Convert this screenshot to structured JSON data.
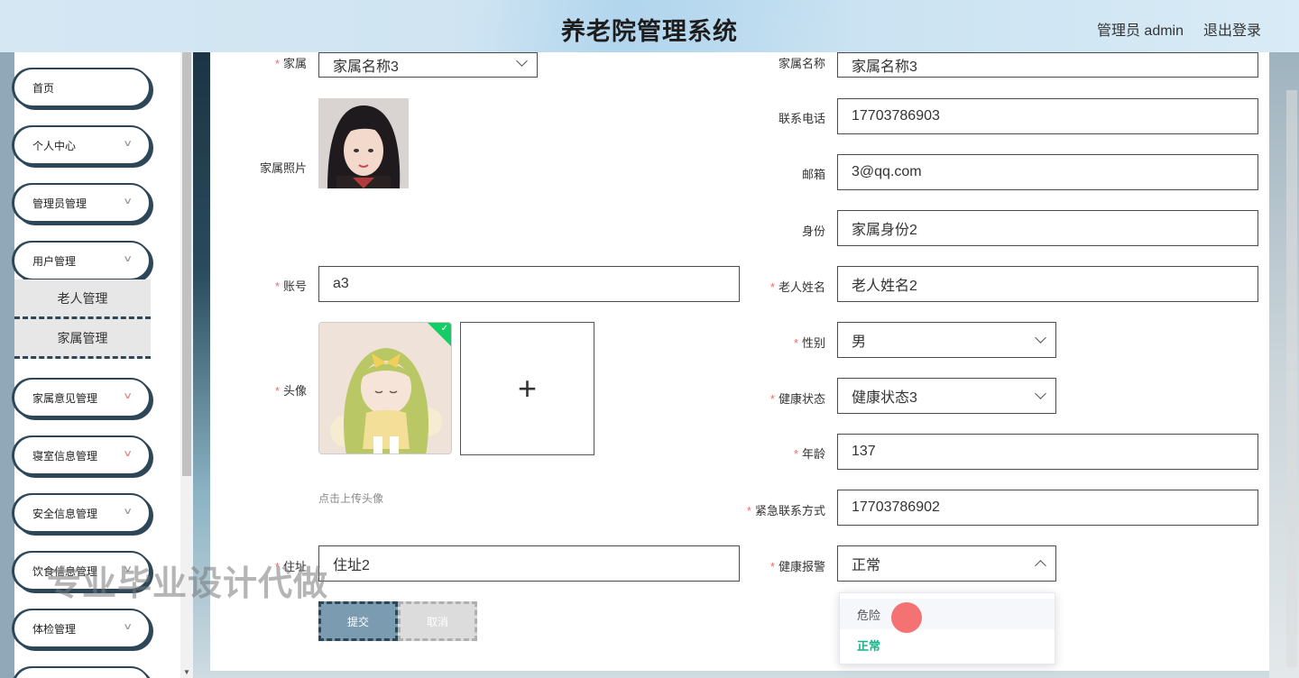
{
  "header": {
    "title": "养老院管理系统",
    "user": "管理员 admin",
    "logout": "退出登录"
  },
  "sidebar": {
    "items": [
      {
        "label": "首页"
      },
      {
        "label": "个人中心"
      },
      {
        "label": "管理员管理"
      },
      {
        "label": "用户管理"
      },
      {
        "label": "家属意见管理"
      },
      {
        "label": "寝室信息管理"
      },
      {
        "label": "安全信息管理"
      },
      {
        "label": "饮食信息管理"
      },
      {
        "label": "体检管理"
      }
    ],
    "subitems": [
      {
        "label": "老人管理"
      },
      {
        "label": "家属管理"
      }
    ]
  },
  "form": {
    "family_select": {
      "label": "家属",
      "value": "家属名称3"
    },
    "family_name": {
      "label": "家属名称",
      "value": "家属名称3"
    },
    "family_photo": {
      "label": "家属照片"
    },
    "phone": {
      "label": "联系电话",
      "value": "17703786903"
    },
    "email": {
      "label": "邮箱",
      "value": "3@qq.com"
    },
    "identity": {
      "label": "身份",
      "value": "家属身份2"
    },
    "account": {
      "label": "账号",
      "value": "a3"
    },
    "elder_name": {
      "label": "老人姓名",
      "value": "老人姓名2"
    },
    "avatar": {
      "label": "头像",
      "hint": "点击上传头像",
      "add_glyph": "+"
    },
    "gender": {
      "label": "性别",
      "value": "男"
    },
    "health_status": {
      "label": "健康状态",
      "value": "健康状态3"
    },
    "age": {
      "label": "年龄",
      "value": "137"
    },
    "emergency": {
      "label": "紧急联系方式",
      "value": "17703786902"
    },
    "address": {
      "label": "住址",
      "value": "住址2"
    },
    "health_alert": {
      "label": "健康报警",
      "value": "正常",
      "options": [
        "危险",
        "正常"
      ]
    },
    "submit": "提交",
    "cancel": "取消"
  },
  "watermark": "专业毕业设计代做",
  "colors": {
    "accent": "#2d4758",
    "required": "#f56c6c",
    "selected_option": "#19b38a"
  }
}
